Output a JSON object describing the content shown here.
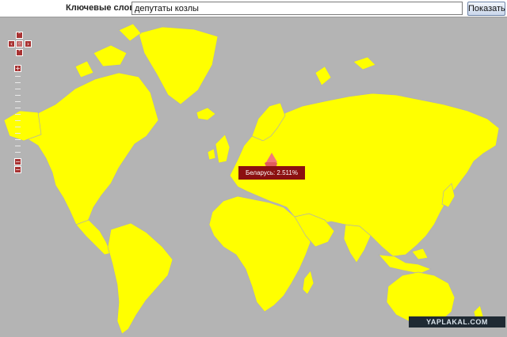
{
  "search": {
    "label": "Ключевые слова:",
    "value": "депутаты козлы",
    "button_label": "Показать"
  },
  "map": {
    "tooltip": "Беларусь: 2.511%",
    "land_color": "#ffff00",
    "water_color": "#b4b4b4",
    "highlight_color": "#e05d5d",
    "zoom_in_label": "+",
    "zoom_out_label": "−"
  },
  "watermark": "YAPLAKAL.COM"
}
